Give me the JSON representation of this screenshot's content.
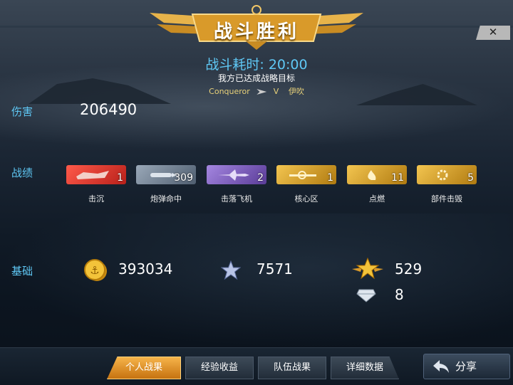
{
  "banner": {
    "title": "战斗胜利"
  },
  "close_label": "✕",
  "battle": {
    "duration": "战斗耗时: 20:00",
    "goal": "我方已达成战略目标",
    "player_ship": "Conqueror",
    "vs": "V",
    "enemy_ship": "伊吹"
  },
  "damage": {
    "label": "伤害",
    "value": "206490"
  },
  "record": {
    "label": "战绩",
    "badges": [
      {
        "name": "击沉",
        "count": "1",
        "color": "#d8302a",
        "icon": "sunk-ship-icon"
      },
      {
        "name": "炮弹命中",
        "count": "309",
        "color": "#6f7f93",
        "icon": "shell-icon"
      },
      {
        "name": "击落飞机",
        "count": "2",
        "color": "#7a5bb8",
        "icon": "plane-icon"
      },
      {
        "name": "核心区",
        "count": "1",
        "color": "#d4a01c",
        "icon": "citadel-icon"
      },
      {
        "name": "点燃",
        "count": "11",
        "color": "#d4a01c",
        "icon": "fire-icon"
      },
      {
        "name": "部件击毁",
        "count": "5",
        "color": "#d4a01c",
        "icon": "gear-icon"
      }
    ]
  },
  "basic": {
    "label": "基础",
    "coins": "393034",
    "exp": "7571",
    "free_exp": "529",
    "gems": "8"
  },
  "tabs": [
    "个人战果",
    "经验收益",
    "队伍战果",
    "详细数据"
  ],
  "share_label": "分享"
}
